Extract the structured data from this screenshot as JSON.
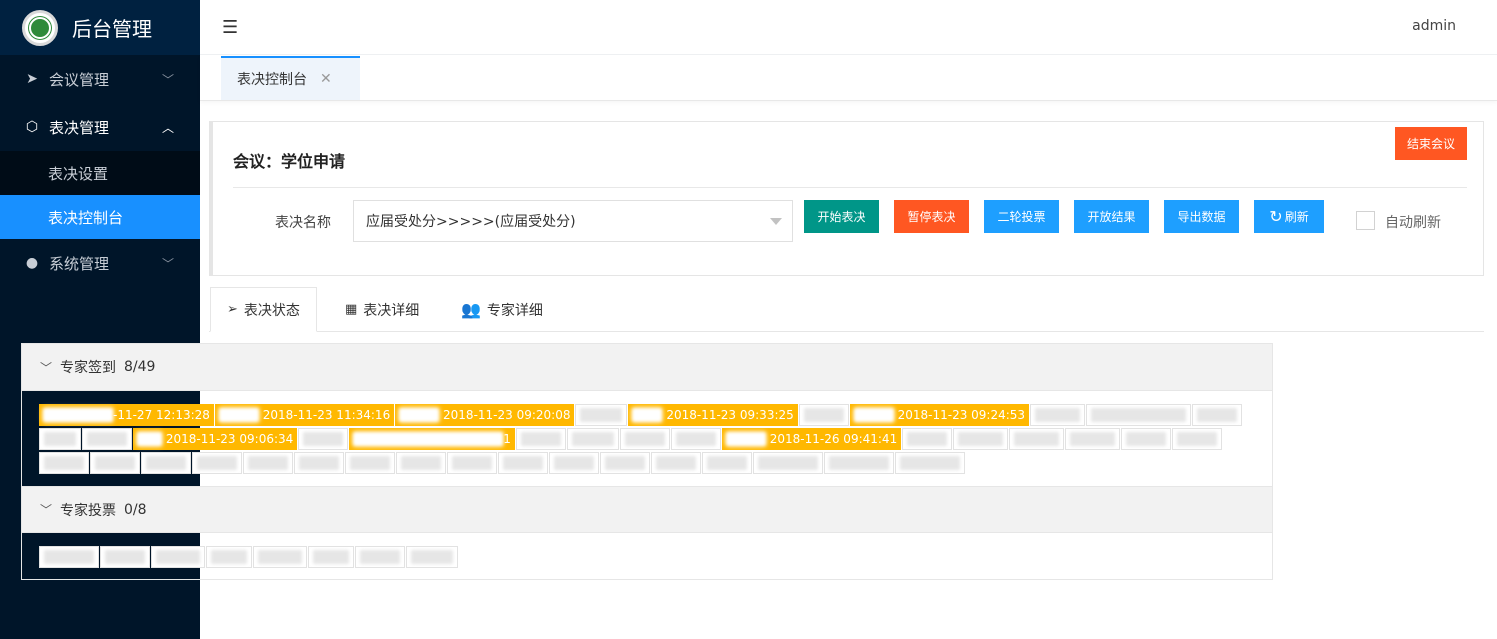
{
  "app": {
    "title": "后台管理",
    "user": "admin"
  },
  "sidebar": {
    "items": [
      {
        "label": "会议管理",
        "icon": "paper-plane-icon"
      },
      {
        "label": "表决管理",
        "icon": "cube-icon",
        "children": [
          {
            "label": "表决设置"
          },
          {
            "label": "表决控制台"
          }
        ]
      },
      {
        "label": "系统管理",
        "icon": "user-icon"
      }
    ]
  },
  "tabs": {
    "open": [
      {
        "label": "表决控制台"
      }
    ]
  },
  "meeting": {
    "title": "会议：学位申请",
    "end_label": "结束会议",
    "vote_name_label": "表决名称",
    "vote_selected": "应届受处分>>>>>(应届受处分)",
    "buttons": {
      "start": "开始表决",
      "pause": "暂停表决",
      "second_round": "二轮投票",
      "open_result": "开放结果",
      "export": "导出数据",
      "refresh": "刷新"
    },
    "auto_refresh_label": "自动刷新",
    "colors": {
      "green": "#009688",
      "orange": "#ff5722",
      "blue": "#1e9fff",
      "signed": "#ffb800",
      "nav_active": "#1890ff"
    }
  },
  "section_tabs": [
    {
      "label": "表决状态",
      "icon": "paper-plane-icon"
    },
    {
      "label": "表决详细",
      "icon": "table-icon"
    },
    {
      "label": "专家详细",
      "icon": "users-icon"
    }
  ],
  "signin": {
    "title": "专家签到",
    "count": "8/49",
    "signed_times": [
      "-11-27 12:13:28",
      "2018-11-23 11:34:16",
      "2018-11-23 09:20:08",
      "2018-11-23 09:33:25",
      "2018-11-23 09:24:53",
      "2018-11-23 09:06:34",
      "1",
      "2018-11-26 09:41:41"
    ]
  },
  "votes": {
    "title": "专家投票",
    "count": "0/8"
  }
}
